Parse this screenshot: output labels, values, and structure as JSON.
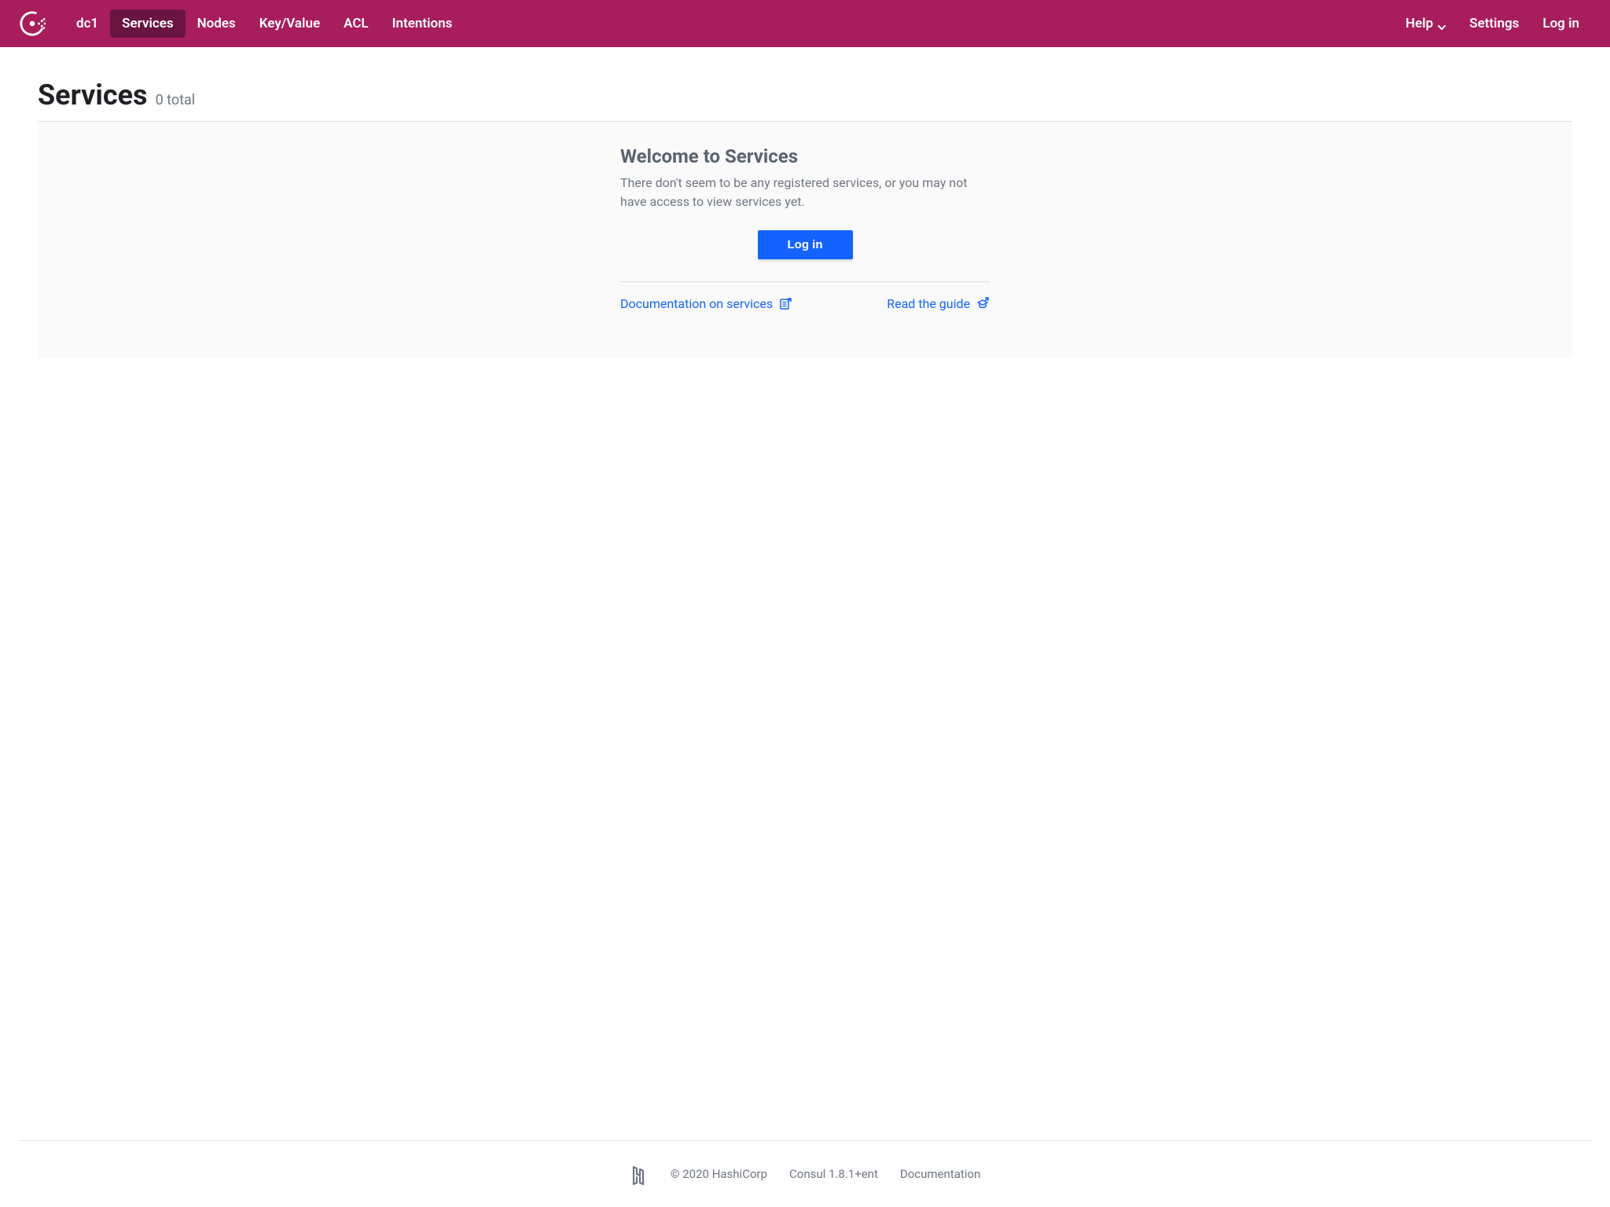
{
  "nav": {
    "dc": "dc1",
    "items": [
      "Services",
      "Nodes",
      "Key/Value",
      "ACL",
      "Intentions"
    ],
    "help": "Help",
    "settings": "Settings",
    "login": "Log in"
  },
  "page": {
    "title": "Services",
    "count_text": "0 total"
  },
  "empty": {
    "title": "Welcome to Services",
    "text": "There don't seem to be any registered services, or you may not have access to view services yet.",
    "login_button": "Log in",
    "doc_link": "Documentation on services",
    "guide_link": "Read the guide"
  },
  "footer": {
    "copyright": "© 2020 HashiCorp",
    "version": "Consul 1.8.1+ent",
    "documentation": "Documentation"
  }
}
